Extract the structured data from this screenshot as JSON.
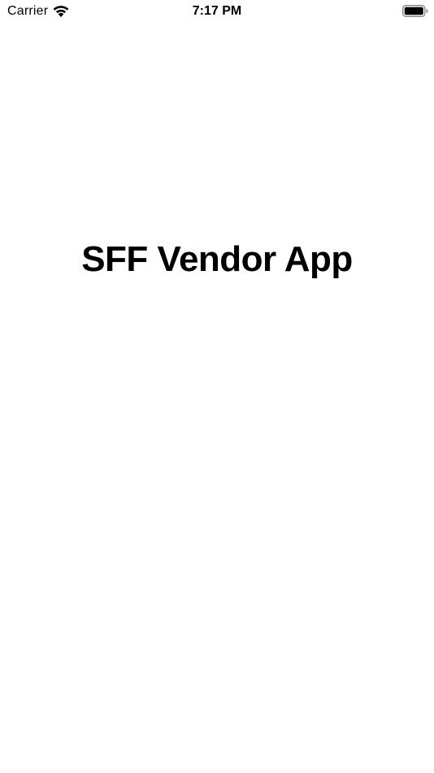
{
  "status_bar": {
    "carrier": "Carrier",
    "time": "7:17 PM",
    "wifi_icon": "wifi-icon",
    "battery_icon": "battery-icon",
    "battery_level": 1.0
  },
  "main": {
    "title": "SFF Vendor App"
  },
  "colors": {
    "background": "#ffffff",
    "text": "#000000"
  }
}
